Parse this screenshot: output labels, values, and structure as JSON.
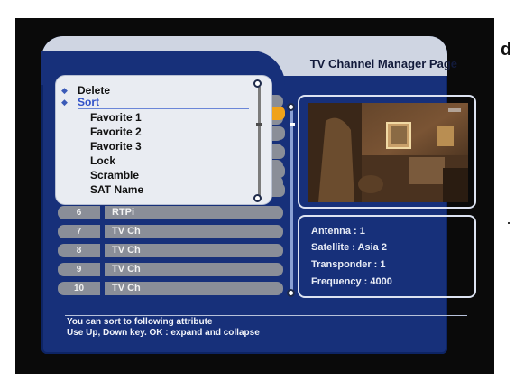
{
  "page": {
    "title": "TV Channel Manager Page",
    "edge_text": "d"
  },
  "menu": {
    "top_items": [
      {
        "label": "Delete"
      },
      {
        "label": "Sort"
      }
    ],
    "sort_options": [
      {
        "label": "Favorite 1"
      },
      {
        "label": "Favorite 2"
      },
      {
        "label": "Favorite 3"
      },
      {
        "label": "Lock"
      },
      {
        "label": "Scramble"
      },
      {
        "label": "SAT Name"
      }
    ]
  },
  "channels": [
    {
      "number": "6",
      "name": "RTPi"
    },
    {
      "number": "7",
      "name": "TV Ch"
    },
    {
      "number": "8",
      "name": "TV Ch"
    },
    {
      "number": "9",
      "name": "TV Ch"
    },
    {
      "number": "10",
      "name": "TV Ch"
    }
  ],
  "info": {
    "antenna": "Antenna : 1",
    "satellite": "Satellite : Asia 2",
    "transponder": "Transponder : 1",
    "frequency": "Frequency : 4000"
  },
  "help": {
    "line1": "You can sort to following attribute",
    "line2": "Use Up, Down key. OK : expand and collapse"
  },
  "colors": {
    "frame": "#17307a",
    "highlight": "#f0a21a",
    "row": "#8a8e98",
    "menu_bg": "#e9ecf2"
  }
}
